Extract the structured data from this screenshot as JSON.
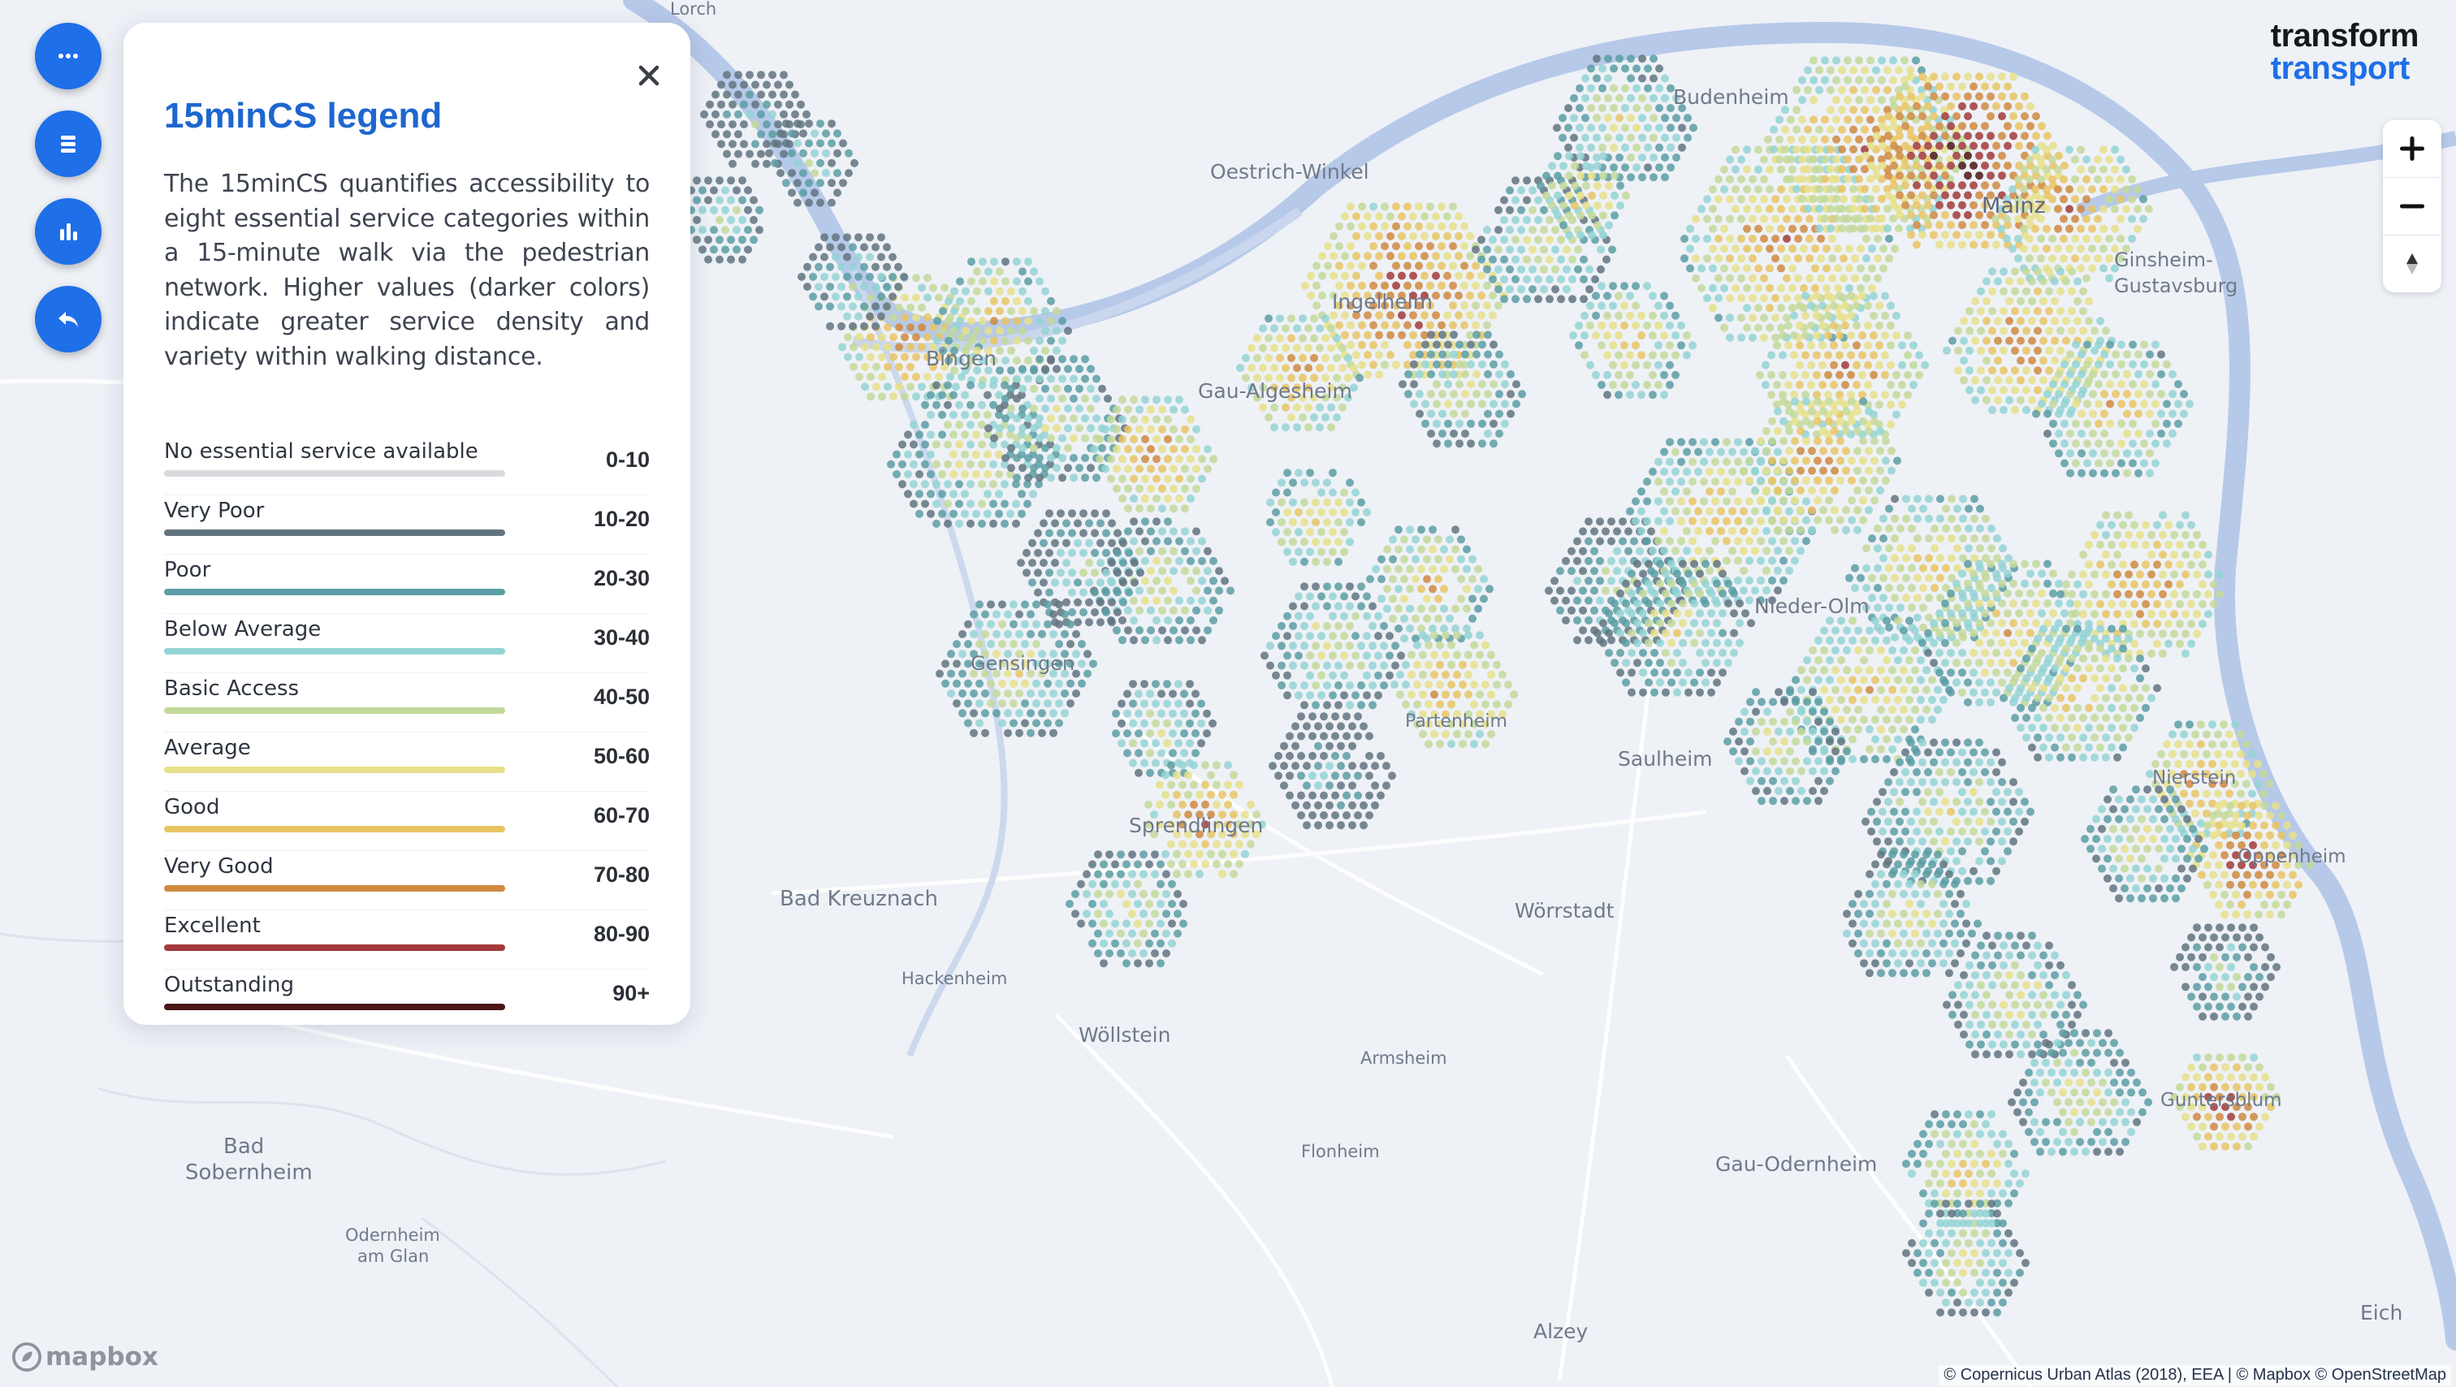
{
  "brand": {
    "line1": "transform",
    "line2": "transport"
  },
  "legend": {
    "title": "15minCS legend",
    "description": "The 15minCS quantifies accessibility to eight essential service categories within a 15-minute walk via the pedestrian network. Higher values (darker colors) indicate greater service density and variety within walking distance.",
    "items": [
      {
        "label": "No essential service available",
        "range": "0-10",
        "color": "#d9dadd"
      },
      {
        "label": "Very Poor",
        "range": "10-20",
        "color": "#627480"
      },
      {
        "label": "Poor",
        "range": "20-30",
        "color": "#5b9ea3"
      },
      {
        "label": "Below Average",
        "range": "30-40",
        "color": "#93d4d3"
      },
      {
        "label": "Basic Access",
        "range": "40-50",
        "color": "#c3d99a"
      },
      {
        "label": "Average",
        "range": "50-60",
        "color": "#e6e18a"
      },
      {
        "label": "Good",
        "range": "60-70",
        "color": "#e8c463"
      },
      {
        "label": "Very Good",
        "range": "70-80",
        "color": "#cf8a3f"
      },
      {
        "label": "Excellent",
        "range": "80-90",
        "color": "#a23a3a"
      },
      {
        "label": "Outstanding",
        "range": "90+",
        "color": "#4a1515"
      }
    ]
  },
  "places": {
    "oestrich": "Oestrich-Winkel",
    "budenheim": "Budenheim",
    "mainz": "Mainz",
    "ginsheim1": "Ginsheim-",
    "ginsheim2": "Gustavsburg",
    "ingelheim": "Ingelheim",
    "gau_algesheim": "Gau-Algesheim",
    "bingen": "Bingen",
    "nieder_olm": "Nieder-Olm",
    "saulheim": "Saulheim",
    "sprendlingen": "Sprendlingen",
    "gensingen": "Gensingen",
    "partenheim": "Partenheim",
    "bad_kreuznach": "Bad Kreuznach",
    "woerrstadt": "Wörrstadt",
    "hackenheim": "Hackenheim",
    "woellstein": "Wöllstein",
    "armsheim": "Armsheim",
    "bad1": "Bad",
    "sobernheim": "Sobernheim",
    "flonheim": "Flonheim",
    "gau_odernheim": "Gau-Odernheim",
    "odernheim1": "Odernheim",
    "odernheim2": "am Glan",
    "alzey": "Alzey",
    "eich": "Eich",
    "nierstein": "Nierstein",
    "oppenheim": "Oppenheim",
    "guntersblum": "Guntersblum",
    "lorch": "Lorch"
  },
  "controls": {
    "zoom_in": "+",
    "zoom_out": "−"
  },
  "footer": {
    "mapbox": "mapbox",
    "attribution": "© Copernicus Urban Atlas (2018), EEA | © Mapbox © OpenStreetMap"
  },
  "colors": {
    "accent": "#1e6fe8",
    "title": "#1e66d0",
    "river": "#b7c9e9",
    "land": "#eef1f6"
  },
  "icons": {
    "fab1": "more-dots-icon",
    "fab2": "list-icon",
    "fab3": "bar-chart-icon",
    "fab4": "back-arrow-icon",
    "close": "close-icon",
    "compass": "compass-icon"
  }
}
